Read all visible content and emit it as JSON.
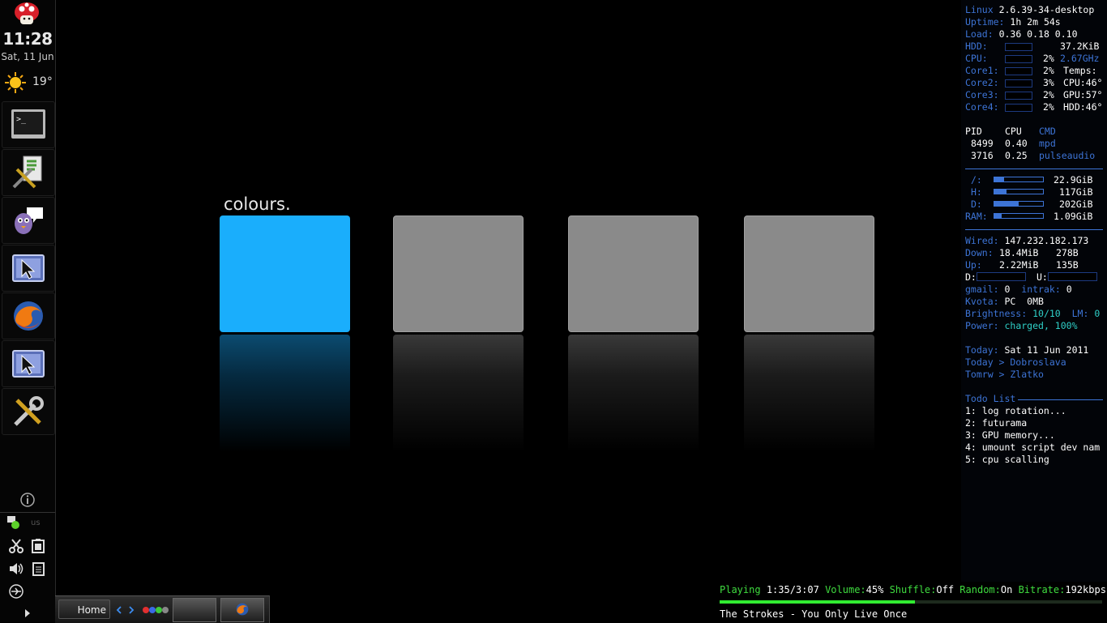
{
  "clock": {
    "time": "11:28",
    "date": "Sat, 11 Jun"
  },
  "weather": {
    "icon": "sun-icon",
    "temperature": "19°"
  },
  "launchers": [
    {
      "name": "terminal-icon"
    },
    {
      "name": "settings-tool-icon"
    },
    {
      "name": "pidgin-chat-icon"
    },
    {
      "name": "window-selector-icon"
    },
    {
      "name": "firefox-icon"
    },
    {
      "name": "window-selector-icon"
    },
    {
      "name": "tools-icon"
    }
  ],
  "tray": {
    "keyboard_layout": "us"
  },
  "colours": {
    "label": "colours.",
    "tiles": [
      {
        "color": "#1aaefc",
        "active": true
      },
      {
        "color": "#8a8a8a",
        "active": false
      },
      {
        "color": "#8a8a8a",
        "active": false
      },
      {
        "color": "#8a8a8a",
        "active": false
      }
    ]
  },
  "conky": {
    "kernel_label": "Linux",
    "kernel": "2.6.39-34-desktop",
    "uptime_label": "Uptime:",
    "uptime": "1h 2m 54s",
    "load_label": "Load:",
    "load": "0.36 0.18 0.10",
    "hdd_label": "HDD:",
    "hdd_value": "37.2KiB",
    "cpu_label": "CPU:",
    "cpu_pct": "2%",
    "cpu_freq": "2.67GHz",
    "cores": [
      {
        "label": "Core1:",
        "pct": "2%",
        "temp": "Temps:"
      },
      {
        "label": "Core2:",
        "pct": "3%",
        "temp": "CPU:46°"
      },
      {
        "label": "Core3:",
        "pct": "2%",
        "temp": "GPU:57°"
      },
      {
        "label": "Core4:",
        "pct": "2%",
        "temp": "HDD:46°"
      }
    ],
    "proc_headers": {
      "pid": "PID",
      "cpu": "CPU",
      "cmd": "CMD"
    },
    "processes": [
      {
        "pid": "8499",
        "cpu": "0.40",
        "cmd": "mpd"
      },
      {
        "pid": "3716",
        "cpu": "0.25",
        "cmd": "pulseaudio"
      }
    ],
    "disks": [
      {
        "label": "/:",
        "value": "22.9GiB",
        "fill": 0.2
      },
      {
        "label": "H:",
        "value": "117GiB",
        "fill": 0.25
      },
      {
        "label": "D:",
        "value": "202GiB",
        "fill": 0.5
      },
      {
        "label": "RAM:",
        "value": "1.09GiB",
        "fill": 0.15
      }
    ],
    "net": {
      "wired_label": "Wired:",
      "wired": "147.232.182.173",
      "down_label": "Down:",
      "down_total": "18.4MiB",
      "down_rate": "278B",
      "up_label": "Up:",
      "up_total": "2.22MiB",
      "up_rate": "135B",
      "d_label": "D:",
      "u_label": "U:"
    },
    "gmail_label": "gmail:",
    "gmail": "0",
    "intrak_label": "intrak:",
    "intrak": "0",
    "kvota_label": "Kvota:",
    "kvota": "PC  0MB",
    "brightness_label": "Brightness:",
    "brightness": "10/10",
    "lm_label": "LM:",
    "lm": "0",
    "power_label": "Power:",
    "power": "charged, 100%",
    "today_label": "Today:",
    "today": "Sat 11 Jun 2011",
    "nameday_today": "Today > Dobroslava",
    "nameday_tomorrow": "Tomrw > Zlatko",
    "todo_title": "Todo List",
    "todos": [
      "1: log rotation...",
      "2: futurama",
      "3: GPU memory...",
      "4: umount script dev nam",
      "5: cpu scalling"
    ]
  },
  "mpd": {
    "status_label": "Playing",
    "time": "1:35/3:07",
    "volume_label": "Volume:",
    "volume": "45%",
    "shuffle_label": "Shuffle:",
    "shuffle": "Off",
    "random_label": "Random:",
    "random": "On",
    "bitrate_label": "Bitrate:",
    "bitrate": "192kbps",
    "progress": 0.51,
    "song": "The Strokes - You Only Live Once"
  },
  "taskbar": {
    "home_label": "Home"
  }
}
